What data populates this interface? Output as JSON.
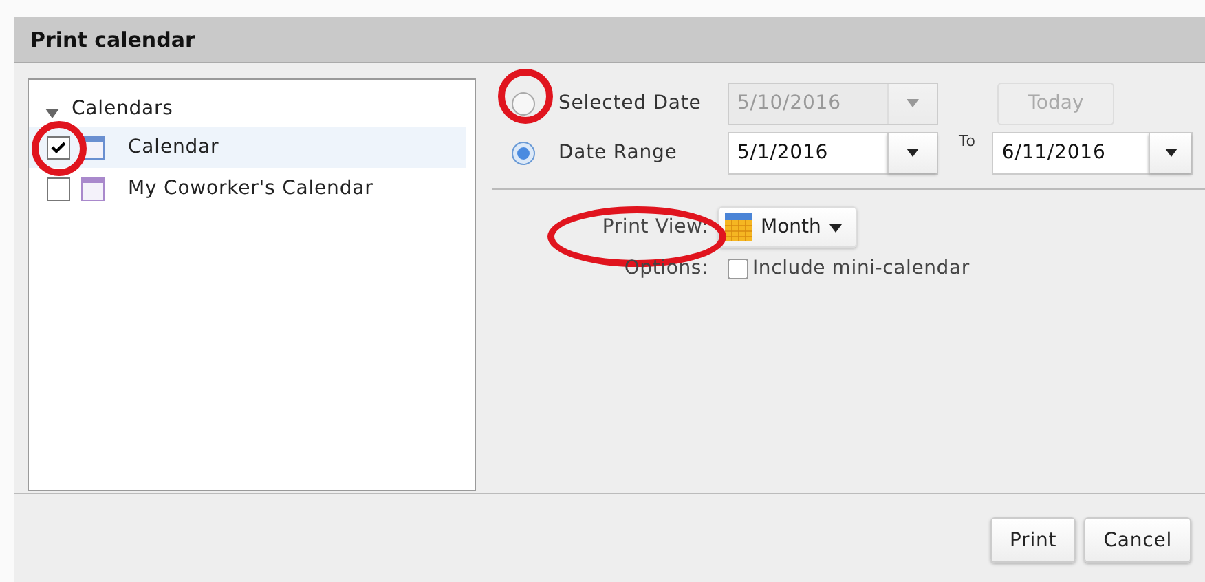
{
  "window": {
    "title": "Print calendar"
  },
  "calendars": {
    "label": "Calendars",
    "expanded": true,
    "items": [
      {
        "name": "Calendar",
        "checked": true,
        "selected": true,
        "highlighted": true,
        "color": "#6a8fd0"
      },
      {
        "name": "My Coworker's Calendar",
        "checked": false,
        "selected": false,
        "highlighted": false,
        "color": "#a989cc"
      }
    ]
  },
  "selected_date": {
    "label": "Selected Date",
    "selected": false,
    "highlighted": true,
    "value": "5/10/2016",
    "today": "Today"
  },
  "date_range": {
    "label": "Date Range",
    "selected": true,
    "start": "5/1/2016",
    "to": "To",
    "end": "6/11/2016"
  },
  "print_view": {
    "label": "Print View:",
    "highlighted": true,
    "value": "Month"
  },
  "options": {
    "label": "Options:",
    "items": [
      {
        "label": "Include mini-calendar",
        "checked": false
      }
    ]
  },
  "buttons": [
    "Print",
    "Cancel"
  ]
}
